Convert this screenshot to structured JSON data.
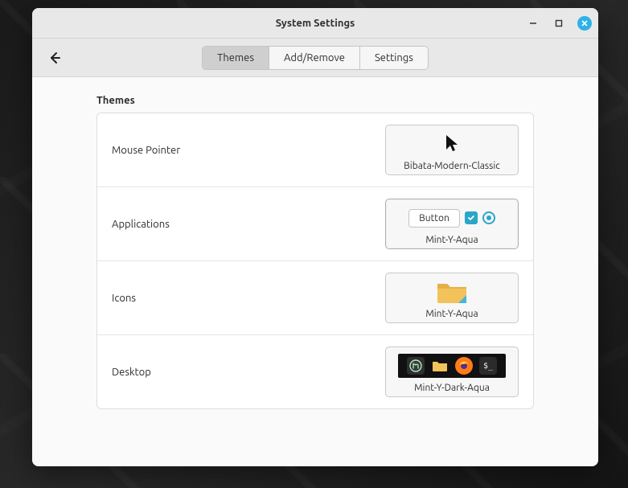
{
  "window": {
    "title": "System Settings"
  },
  "tabs": {
    "themes": "Themes",
    "addremove": "Add/Remove",
    "settings": "Settings"
  },
  "section": {
    "heading": "Themes"
  },
  "rows": {
    "mouse": {
      "label": "Mouse Pointer",
      "value": "Bibata-Modern-Classic"
    },
    "applications": {
      "label": "Applications",
      "button_text": "Button",
      "value": "Mint-Y-Aqua"
    },
    "icons": {
      "label": "Icons",
      "value": "Mint-Y-Aqua"
    },
    "desktop": {
      "label": "Desktop",
      "value": "Mint-Y-Dark-Aqua"
    }
  },
  "colors": {
    "accent": "#2aa6c9",
    "close_button": "#2eb2e6"
  }
}
